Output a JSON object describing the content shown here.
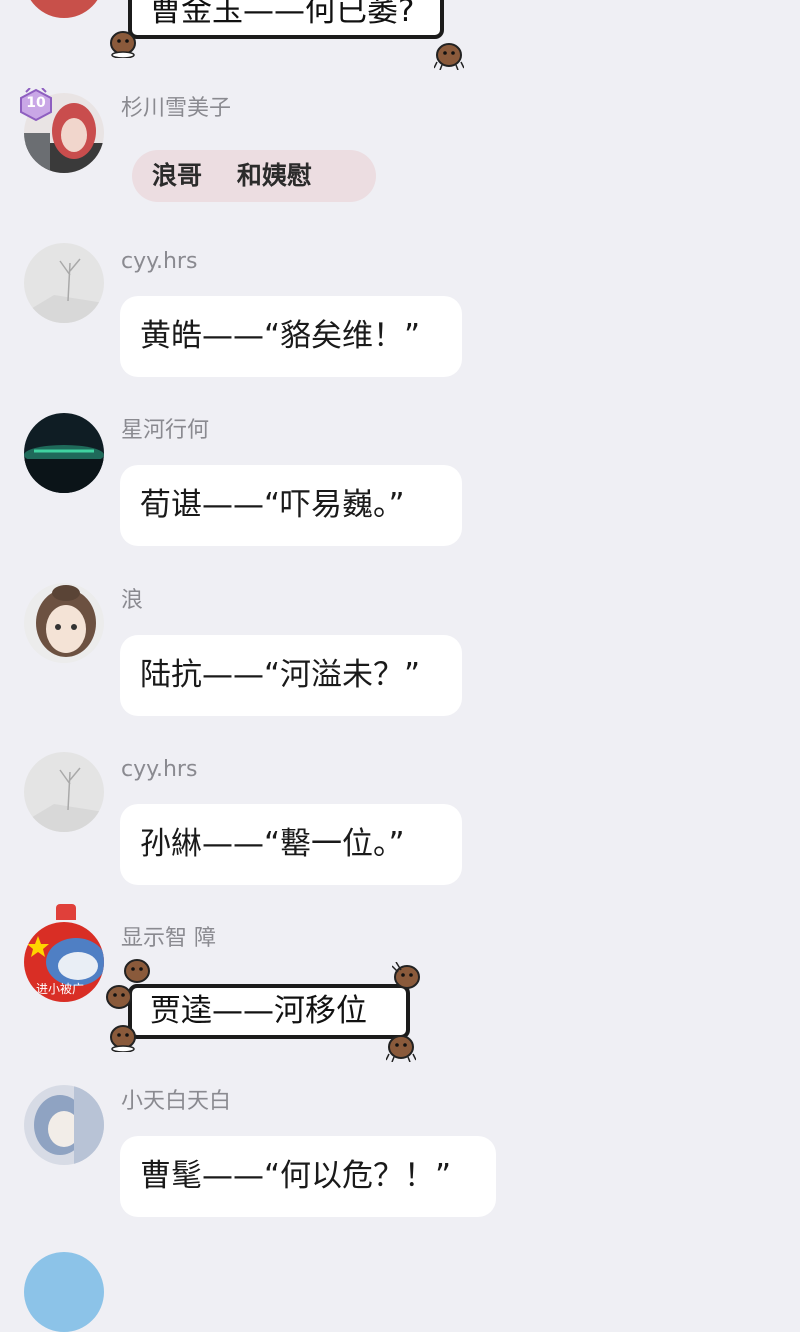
{
  "top_partial_message": {
    "text": "曹金玉——何已萎?"
  },
  "messages": [
    {
      "sender": "杉川雪美子",
      "text": "浪哥    和姨慰",
      "level_badge": "10"
    },
    {
      "sender": "cyy.hrs",
      "text": "黄皓——“貉矣维！”"
    },
    {
      "sender": "星河行何",
      "text": "荀谌——“吓易巍。”"
    },
    {
      "sender": "浪",
      "text": "陆抗——“河溢未？”"
    },
    {
      "sender": "cyy.hrs",
      "text": "孙綝——“罊一位。”"
    },
    {
      "sender": "显示智 障",
      "text": "贾逵——河移位",
      "avatar_text": "进小被广"
    },
    {
      "sender": "小天白天白",
      "text": "曹髦——“何以危？！”"
    }
  ],
  "colors": {
    "background": "#efeff4",
    "bubble": "#ffffff",
    "pink_bubble": "#ecdde1",
    "sender_name": "#8a8a90",
    "level_badge": "#b58ad6"
  },
  "icons": [
    "level-badge-icon",
    "potato-critter-icon"
  ]
}
